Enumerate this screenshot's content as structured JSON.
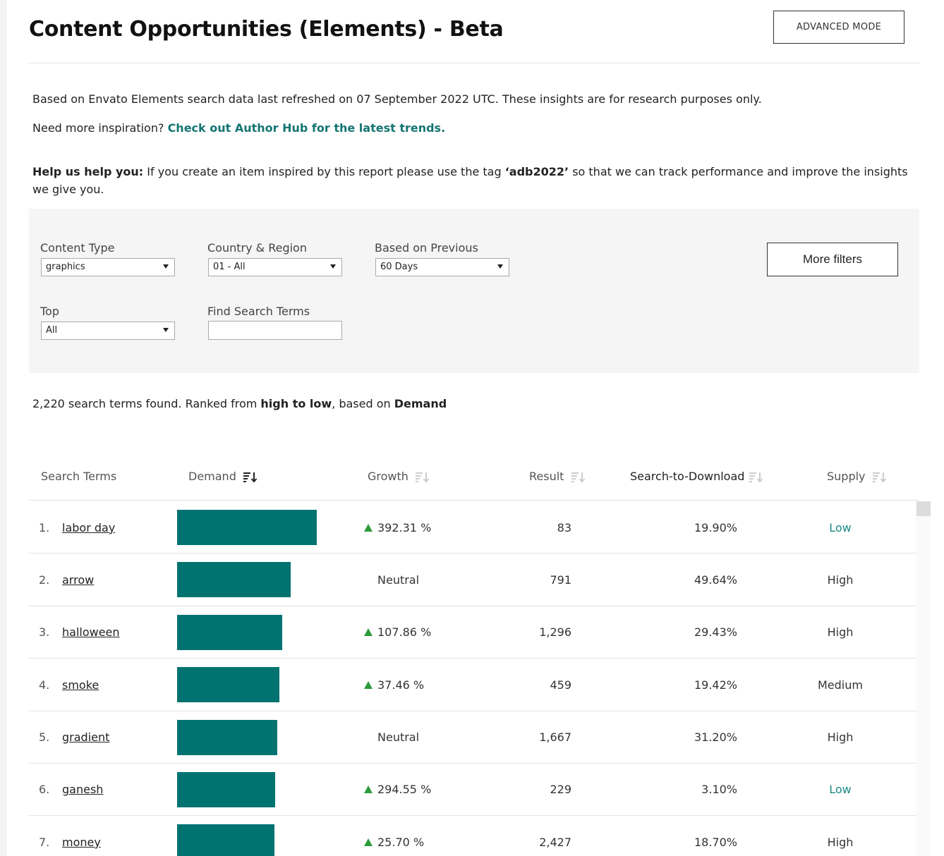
{
  "header": {
    "title": "Content Opportunities (Elements) - Beta",
    "advanced_mode_label": "ADVANCED MODE"
  },
  "intro": {
    "refresh_text": "Based on Envato Elements search data last refreshed on 07 September 2022 UTC. These insights are for research purposes only.",
    "inspiration_prefix": "Need more inspiration? ",
    "inspiration_link": "Check out Author Hub for the latest trends.",
    "help_bold": "Help us help you:",
    "help_text_1": " If you create an item inspired by this report please use the tag ",
    "help_tag": "‘adb2022’",
    "help_text_2": " so that we can track performance and improve the insights we give you."
  },
  "filters": {
    "content_type": {
      "label": "Content Type",
      "value": "graphics"
    },
    "country_region": {
      "label": "Country & Region",
      "value": "01 - All"
    },
    "based_on_previous": {
      "label": "Based on Previous",
      "value": "60 Days"
    },
    "top": {
      "label": "Top",
      "value": "All"
    },
    "find_search_terms": {
      "label": "Find Search Terms",
      "value": ""
    },
    "more_filters_label": "More filters"
  },
  "summary": {
    "count": "2,220",
    "text_1": "  search terms found. Ranked from ",
    "order": "high to low",
    "text_2": ", based on ",
    "metric": "Demand"
  },
  "table": {
    "columns": {
      "search_terms": "Search Terms",
      "demand": "Demand",
      "growth": "Growth",
      "result": "Result",
      "search_to_download": "Search-to-Download",
      "supply": "Supply"
    },
    "rows": [
      {
        "rank": "1.",
        "term": "labor day",
        "demand": 1.0,
        "growth": "392.31 %",
        "growth_up": true,
        "result": "83",
        "s2d": "19.90%",
        "supply": "Low"
      },
      {
        "rank": "2.",
        "term": "arrow",
        "demand": 0.815,
        "growth": "Neutral",
        "growth_up": false,
        "result": "791",
        "s2d": "49.64%",
        "supply": "High"
      },
      {
        "rank": "3.",
        "term": "halloween",
        "demand": 0.755,
        "growth": "107.86 %",
        "growth_up": true,
        "result": "1,296",
        "s2d": "29.43%",
        "supply": "High"
      },
      {
        "rank": "4.",
        "term": "smoke",
        "demand": 0.73,
        "growth": "37.46 %",
        "growth_up": true,
        "result": "459",
        "s2d": "19.42%",
        "supply": "Medium"
      },
      {
        "rank": "5.",
        "term": "gradient",
        "demand": 0.718,
        "growth": "Neutral",
        "growth_up": false,
        "result": "1,667",
        "s2d": "31.20%",
        "supply": "High"
      },
      {
        "rank": "6.",
        "term": "ganesh",
        "demand": 0.702,
        "growth": "294.55 %",
        "growth_up": true,
        "result": "229",
        "s2d": "3.10%",
        "supply": "Low"
      },
      {
        "rank": "7.",
        "term": "money",
        "demand": 0.695,
        "growth": "25.70 %",
        "growth_up": true,
        "result": "2,427",
        "s2d": "18.70%",
        "supply": "High"
      }
    ]
  },
  "colors": {
    "bar": "#007371",
    "growth_up": "#2e9b3b",
    "supply_low": "#1b8a85",
    "link": "#137572"
  }
}
